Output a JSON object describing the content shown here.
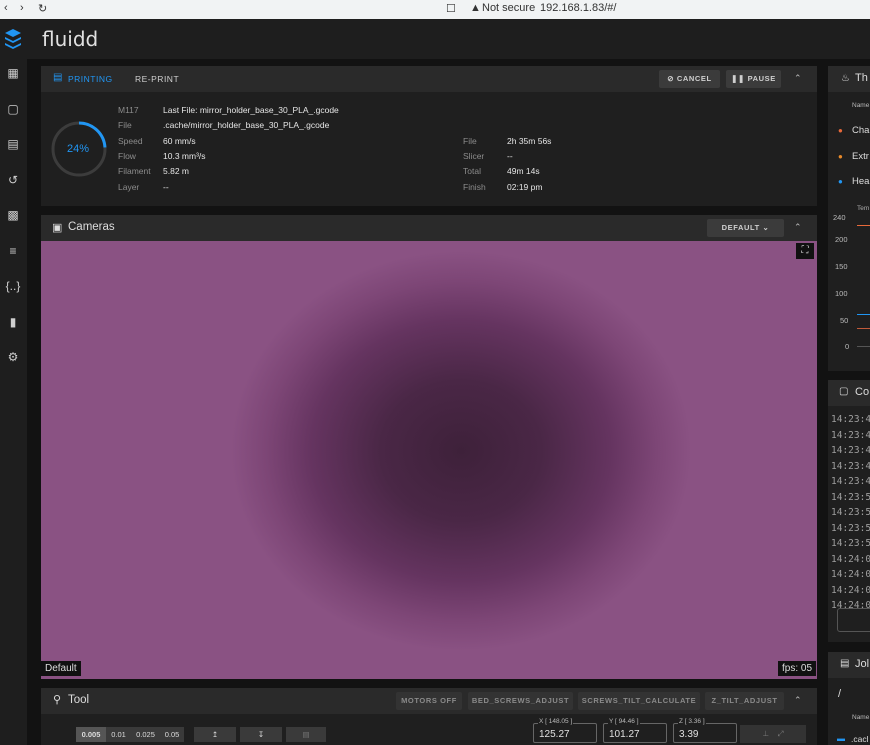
{
  "browser": {
    "security": "Not secure",
    "url": "192.168.1.83/#/"
  },
  "app": {
    "title": "fluidd",
    "accent": "#2196f3"
  },
  "sidebar": {
    "items": [
      "dashboard-icon",
      "console-icon",
      "jobs-icon",
      "history-icon",
      "files-icon",
      "tune-icon",
      "macros-icon",
      "device-icon",
      "settings-icon"
    ]
  },
  "status": {
    "tab_printing": "PRINTING",
    "tab_reprint": "RE-PRINT",
    "cancel": "CANCEL",
    "pause": "PAUSE",
    "progress_label": "24%",
    "progress": 0.24,
    "m117_label": "M117",
    "m117_value": "Last File: mirror_holder_base_30_PLA_.gcode",
    "file_label": "File",
    "file_value": ".cache/mirror_holder_base_30_PLA_.gcode",
    "speed_label": "Speed",
    "speed_value": "60 mm/s",
    "flow_label": "Flow",
    "flow_value": "10.3 mm³/s",
    "filament_label": "Filament",
    "filament_value": "5.82 m",
    "layer_label": "Layer",
    "layer_value": "--",
    "ftime_label": "File",
    "ftime_value": "2h 35m 56s",
    "slicer_label": "Slicer",
    "slicer_value": "--",
    "total_label": "Total",
    "total_value": "49m 14s",
    "finish_label": "Finish",
    "finish_value": "02:19 pm"
  },
  "cameras": {
    "title": "Cameras",
    "default_btn": "DEFAULT",
    "name": "Default",
    "fps": "fps: 05"
  },
  "tool": {
    "title": "Tool",
    "macros": [
      "MOTORS OFF",
      "BED_SCREWS_ADJUST",
      "SCREWS_TILT_CALCULATE",
      "Z_TILT_ADJUST"
    ],
    "steps": [
      "0.005",
      "0.01",
      "0.025",
      "0.05"
    ],
    "x_label": "X [ 148.05 ]",
    "x_value": "125.27",
    "y_label": "Y [ 94.46 ]",
    "y_value": "101.27",
    "z_label": "Z [ 3.36 ]",
    "z_value": "3.39"
  },
  "thermals": {
    "title": "Th",
    "col_name": "Name",
    "rows": [
      "Cha",
      "Extr",
      "Hea"
    ],
    "temp_label": "Tem",
    "y_ticks": [
      "240",
      "200",
      "150",
      "100",
      "50",
      "0"
    ]
  },
  "console": {
    "title": "Co",
    "lines": [
      "14:23:4",
      "14:23:4",
      "14:23:4",
      "14:23:4",
      "14:23:4",
      "14:23:5",
      "14:23:5",
      "14:23:5",
      "14:23:5",
      "14:24:0",
      "14:24:0",
      "14:24:0",
      "14:24:0"
    ]
  },
  "jobs": {
    "title": "Jol",
    "path": "/",
    "col_name": "Name",
    "row": ".cacl"
  }
}
